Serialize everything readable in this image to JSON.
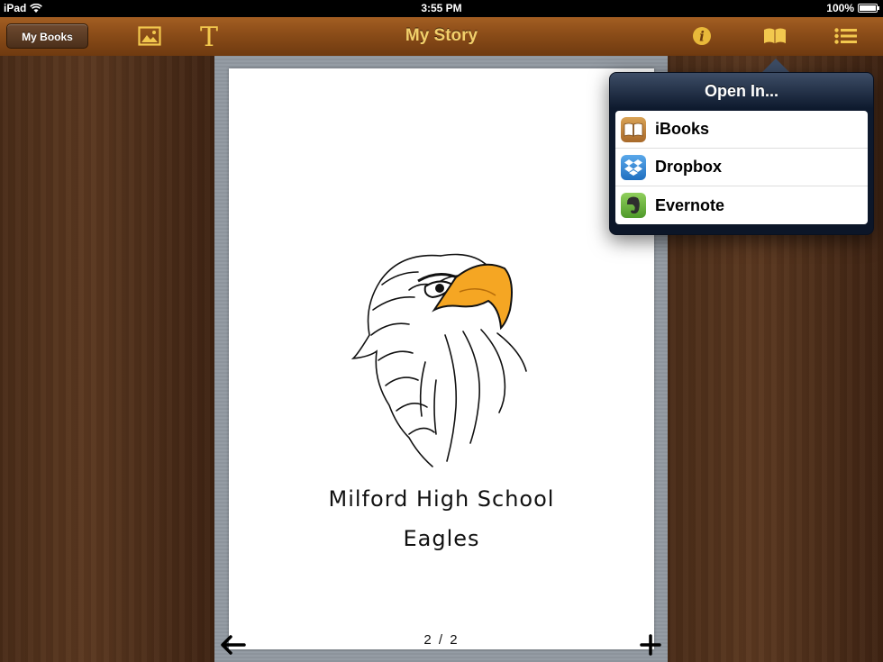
{
  "status_bar": {
    "carrier": "iPad",
    "time": "3:55 PM",
    "battery": "100%",
    "battery_level": 1.0
  },
  "toolbar": {
    "my_books_label": "My Books",
    "title": "My Story",
    "icons": [
      "image-icon",
      "text-icon",
      "info-icon",
      "book-icon",
      "list-icon"
    ]
  },
  "page": {
    "caption_line1": "Milford High School",
    "caption_line2": "Eagles",
    "pager": "2 / 2"
  },
  "popover": {
    "title": "Open In...",
    "items": [
      {
        "label": "iBooks",
        "icon": "ibooks-icon"
      },
      {
        "label": "Dropbox",
        "icon": "dropbox-icon"
      },
      {
        "label": "Evernote",
        "icon": "evernote-icon"
      }
    ]
  },
  "colors": {
    "toolbar": "#8a4c18",
    "title": "#f2d06b",
    "popover": "#0e1a2e",
    "eagle_beak": "#f5a623"
  }
}
